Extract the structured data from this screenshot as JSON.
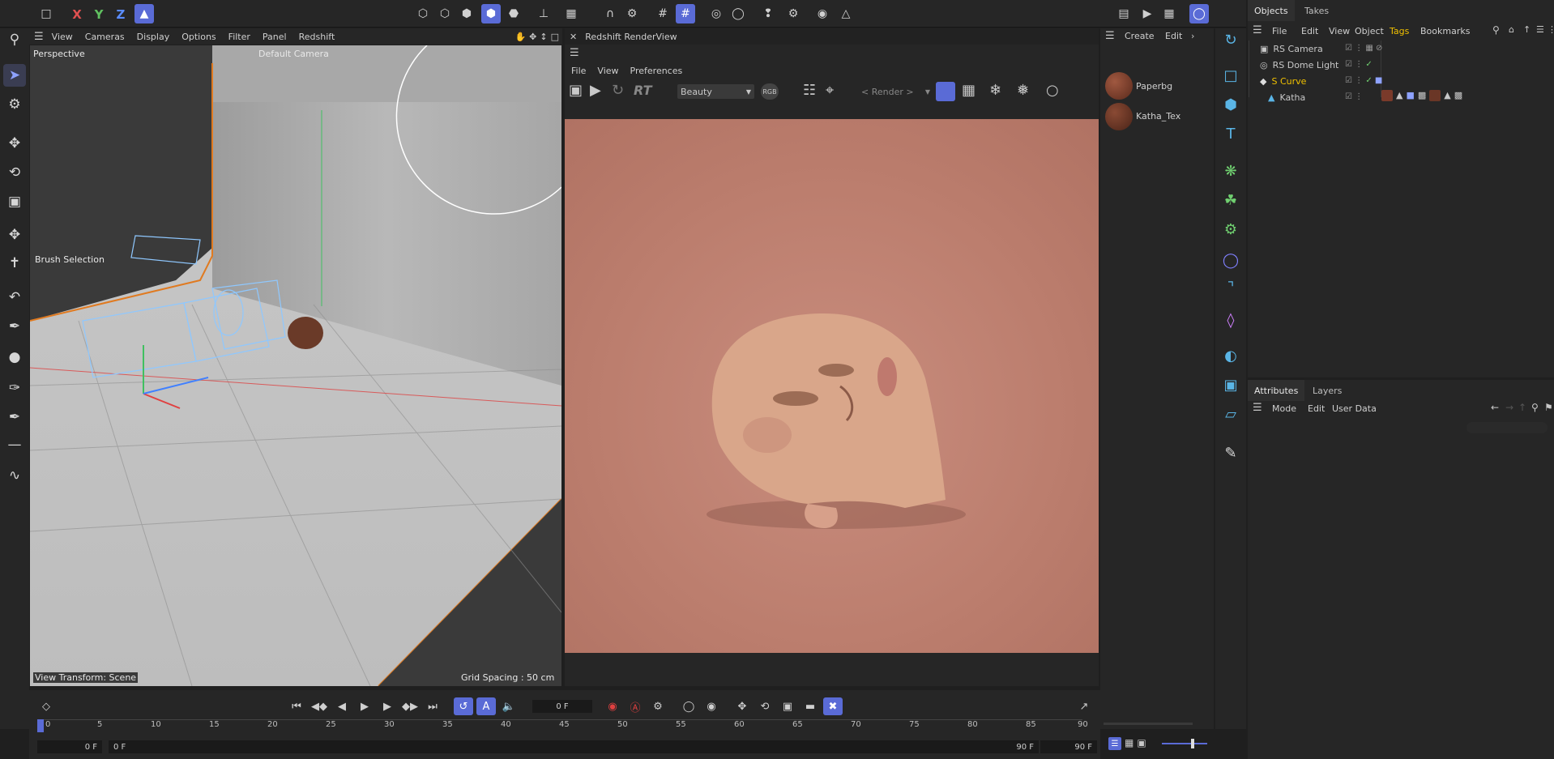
{
  "top_toolbar": {
    "axes": [
      "X",
      "Y",
      "Z"
    ]
  },
  "viewport": {
    "menu": [
      "View",
      "Cameras",
      "Display",
      "Options",
      "Filter",
      "Panel",
      "Redshift"
    ],
    "label": "Perspective",
    "camera": "Default Camera",
    "brush_label": "Brush Selection",
    "view_transform": "View Transform: Scene",
    "grid_spacing": "Grid Spacing : 50 cm"
  },
  "renderview": {
    "title": "Redshift RenderView",
    "menu": [
      "File",
      "View",
      "Preferences"
    ],
    "rt_label": "RT",
    "aov_select": "Beauty",
    "rgb_label": "RGB",
    "render_select": "< Render >"
  },
  "materials": {
    "menu": [
      "Create",
      "Edit"
    ],
    "items": [
      {
        "name": "Paperbg",
        "color": "#7a3a2a"
      },
      {
        "name": "Katha_Tex",
        "color": "#6a3626"
      }
    ]
  },
  "objects_panel": {
    "tabs": [
      "Objects",
      "Takes"
    ],
    "menu": [
      "File",
      "Edit",
      "View",
      "Object",
      "Tags",
      "Bookmarks"
    ],
    "active_menu": "Tags",
    "rows": [
      {
        "name": "RS Camera",
        "icon": "camera-icon",
        "color": "#cfcfcf"
      },
      {
        "name": "RS Dome Light",
        "icon": "globe-icon",
        "color": "#cfcfcf"
      },
      {
        "name": "S Curve",
        "icon": "curve-icon",
        "color": "#f0c000"
      },
      {
        "name": "Katha",
        "icon": "figure-icon",
        "color": "#cfcfcf"
      }
    ]
  },
  "attributes_panel": {
    "tabs": [
      "Attributes",
      "Layers"
    ],
    "menu": [
      "Mode",
      "Edit",
      "User Data"
    ]
  },
  "timeline": {
    "current_frame": "0 F",
    "ticks": [
      "0",
      "5",
      "10",
      "15",
      "20",
      "25",
      "30",
      "35",
      "40",
      "45",
      "50",
      "55",
      "60",
      "65",
      "70",
      "75",
      "80",
      "85",
      "90"
    ],
    "start_field": "0 F",
    "start_field2": "0 F",
    "end_field": "90 F",
    "end_field2": "90 F"
  },
  "colors": {
    "accent": "#5a6bd6",
    "selection_orange": "#e07a20",
    "render_bg": "#bb7d6d"
  }
}
